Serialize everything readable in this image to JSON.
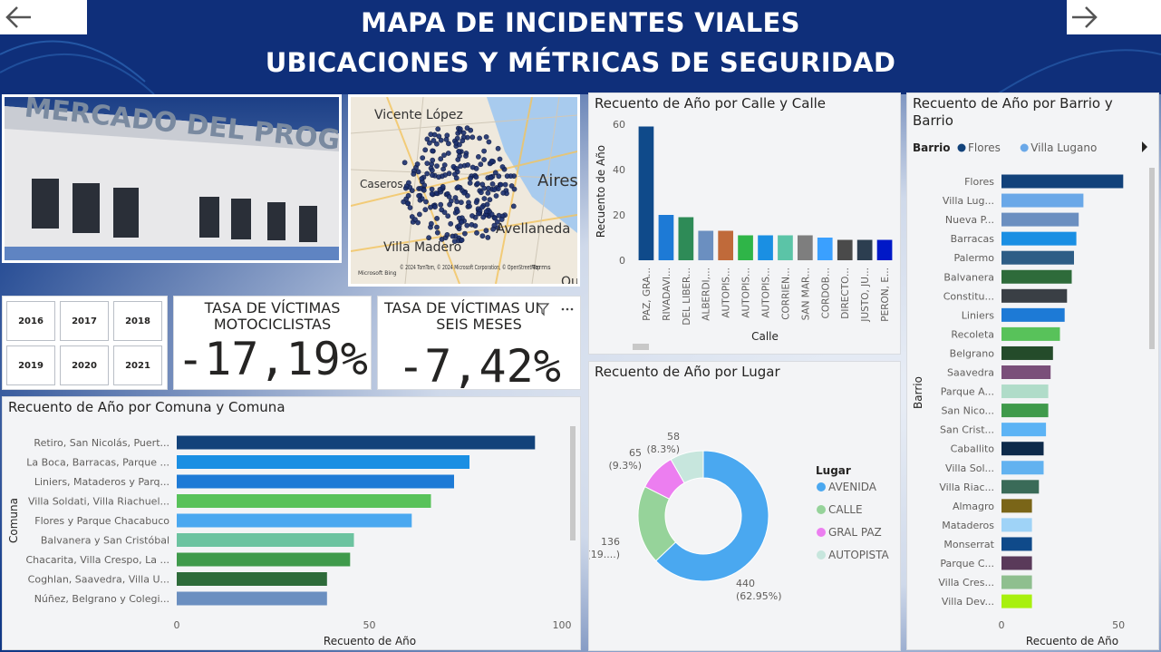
{
  "header": {
    "title_line1": "MAPA DE INCIDENTES VIALES",
    "title_line2": "UBICACIONES Y MÉTRICAS DE SEGURIDAD"
  },
  "map": {
    "labels": [
      "Vicente López",
      "Caseros",
      "Aires",
      "Avellaneda",
      "Villa Madero",
      "Quil"
    ],
    "attribution": "© 2024 TomTom, © 2024 Microsoft Corporation, © OpenStreetMap",
    "terms": "Terms",
    "provider": "Microsoft Bing"
  },
  "years": [
    "2016",
    "2017",
    "2018",
    "2019",
    "2020",
    "2021"
  ],
  "kpi1": {
    "label_line1": "TASA DE VÍCTIMAS",
    "label_line2": "MOTOCICLISTAS",
    "value": "-17,19%"
  },
  "kpi2": {
    "label_line1": "TASA DE VÍCTIMAS UL",
    "label_line2": "SEIS MESES",
    "value": "-7,42%"
  },
  "chart_data": [
    {
      "id": "calle",
      "type": "bar",
      "title": "Recuento de Año por Calle y Calle",
      "xlabel": "Calle",
      "ylabel": "Recuento de Año",
      "ylim": [
        0,
        60
      ],
      "yticks": [
        0,
        20,
        40,
        60
      ],
      "categories": [
        "PAZ, GRA...",
        "RIVADAVI...",
        "DEL LIBER...",
        "ALBERDI,...",
        "AUTOPIS...",
        "AUTOPIS...",
        "AUTOPIS...",
        "CORRIEN...",
        "SAN MAR...",
        "CORDOB...",
        "DIRECTO...",
        "JUSTO, JU...",
        "PERON, E..."
      ],
      "values": [
        59,
        20,
        19,
        13,
        13,
        11,
        11,
        11,
        11,
        10,
        9,
        9,
        9
      ],
      "colors": [
        "#0f4a8a",
        "#1d7ad6",
        "#2e8b57",
        "#6b8fc0",
        "#c06a3a",
        "#2fb548",
        "#1a8fe3",
        "#5bc4a7",
        "#7e7e7e",
        "#3aa0ff",
        "#4a4a4a",
        "#2c3e50",
        "#0018c7"
      ]
    },
    {
      "id": "barrio",
      "type": "bar",
      "title": "Recuento de Año por Barrio y Barrio",
      "legend_title": "Barrio",
      "legend": [
        {
          "name": "Flores",
          "color": "#12427a"
        },
        {
          "name": "Villa Lugano",
          "color": "#6aa8e8"
        }
      ],
      "xlabel": "Recuento de Año",
      "ylabel": "Barrio",
      "xlim": [
        0,
        55
      ],
      "xticks": [
        0,
        50
      ],
      "categories": [
        "Flores",
        "Villa Lug...",
        "Nueva P...",
        "Barracas",
        "Palermo",
        "Balvanera",
        "Constitu...",
        "Liniers",
        "Recoleta",
        "Belgrano",
        "Saavedra",
        "Parque A...",
        "San Nico...",
        "San Crist...",
        "Caballito",
        "Villa Sol...",
        "Villa Riac...",
        "Almagro",
        "Mataderos",
        "Monserrat",
        "Parque C...",
        "Villa Cres...",
        "Villa Dev..."
      ],
      "values": [
        52,
        35,
        33,
        32,
        31,
        30,
        28,
        27,
        25,
        22,
        21,
        20,
        20,
        19,
        18,
        18,
        16,
        13,
        13,
        13,
        13,
        13,
        13
      ],
      "colors": [
        "#12427a",
        "#6aa8e8",
        "#6b8fc0",
        "#1a8fe3",
        "#2e5d86",
        "#2e6b3a",
        "#3a3f45",
        "#1d7ad6",
        "#58c25a",
        "#244b2a",
        "#7a4f7a",
        "#b0dcc9",
        "#3f9a4b",
        "#5cb3f5",
        "#0e2a4a",
        "#62b2f0",
        "#3a6b58",
        "#7a6518",
        "#9fd3f7",
        "#0f4a8a",
        "#5a3a5a",
        "#8fbf8f",
        "#a8f00f"
      ]
    },
    {
      "id": "comuna",
      "type": "bar",
      "title": "Recuento de Año por Comuna y Comuna",
      "xlabel": "Recuento de Año",
      "ylabel": "Comuna",
      "xlim": [
        0,
        100
      ],
      "xticks": [
        0,
        50,
        100
      ],
      "categories": [
        "Retiro, San Nicolás, Puert...",
        "La Boca, Barracas, Parque ...",
        "Liniers, Mataderos y Parq...",
        "Villa Soldati, Villa Riachuel...",
        "Flores y Parque Chacabuco",
        "Balvanera y San Cristóbal",
        "Chacarita, Villa Crespo, La ...",
        "Coghlan, Saavedra, Villa U...",
        "Núñez, Belgrano y Colegi..."
      ],
      "values": [
        93,
        76,
        72,
        66,
        61,
        46,
        45,
        39,
        39
      ],
      "colors": [
        "#12427a",
        "#1a8fe3",
        "#1d7ad6",
        "#58c25a",
        "#4aa8f0",
        "#6cc3a0",
        "#3f9a4b",
        "#2e6b3a",
        "#6b8fc0"
      ]
    },
    {
      "id": "lugar",
      "type": "pie",
      "title": "Recuento de Año por Lugar",
      "legend_title": "Lugar",
      "categories": [
        "AVENIDA",
        "CALLE",
        "GRAL PAZ",
        "AUTOPISTA"
      ],
      "values": [
        440,
        136,
        65,
        58
      ],
      "labels_pct": [
        "(62.95%)",
        "(19....)",
        "(9.3%)",
        "(8.3%)"
      ],
      "colors": [
        "#4aa8f0",
        "#96d39a",
        "#ec7ef0",
        "#c7e6dd"
      ]
    }
  ]
}
